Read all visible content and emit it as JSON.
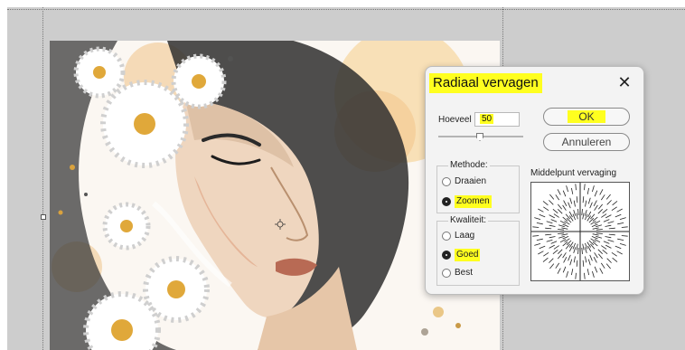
{
  "dialog": {
    "title": "Radiaal vervagen",
    "close_icon": "close-icon",
    "amount_label": "Hoeveel",
    "amount_value": "50",
    "amount_level_percent": 50,
    "ok_label": "OK",
    "cancel_label": "Annuleren",
    "method": {
      "label": "Methode:",
      "options": [
        "Draaien",
        "Zoomen"
      ],
      "selected": "Zoomen"
    },
    "quality": {
      "label": "Kwaliteit:",
      "options": [
        "Laag",
        "Goed",
        "Best"
      ],
      "selected": "Goed"
    },
    "center_label": "Middelpunt vervaging"
  },
  "colors": {
    "highlight": "#ffff1f",
    "workspace": "#cdcdcd",
    "dialog_bg": "#f3f3f3"
  },
  "canvas": {
    "image_subject": "watercolor-woman-portrait-with-daisies",
    "cursor_icon": "crosshair-cursor-icon"
  }
}
